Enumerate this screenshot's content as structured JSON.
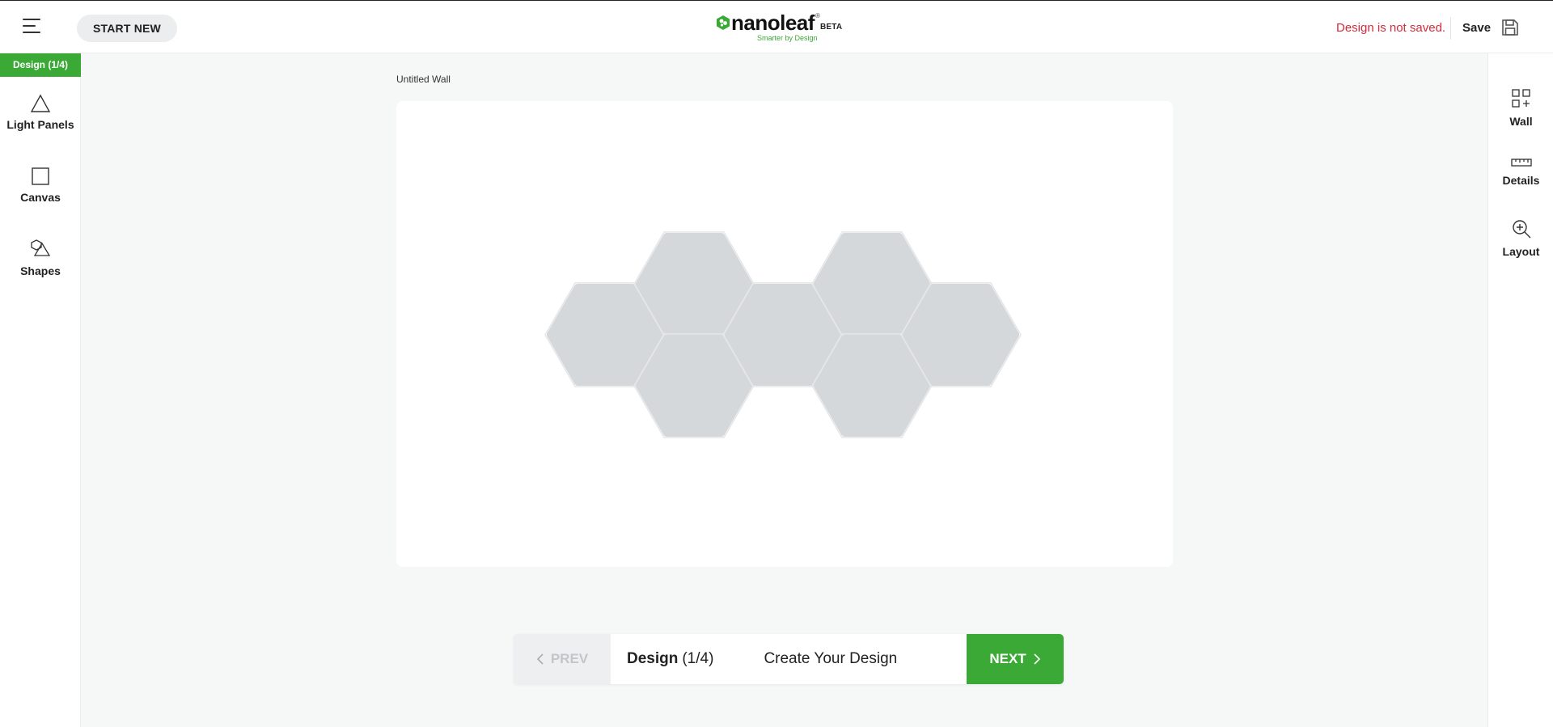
{
  "header": {
    "start_new_label": "START NEW",
    "logo": {
      "wordmark": "nanoleaf",
      "registered": "®",
      "beta": "BETA",
      "tagline": "Smarter by Design"
    },
    "status_text": "Design is not saved.",
    "save_label": "Save"
  },
  "left_toolbar": {
    "step_badge": "Design (1/4)",
    "tools": [
      {
        "label": "Light Panels",
        "icon": "triangle-icon"
      },
      {
        "label": "Canvas",
        "icon": "square-icon"
      },
      {
        "label": "Shapes",
        "icon": "shapes-icon"
      }
    ]
  },
  "right_toolbar": {
    "tools": [
      {
        "label": "Wall",
        "icon": "grid-add-icon"
      },
      {
        "label": "Details",
        "icon": "ruler-icon"
      },
      {
        "label": "Layout",
        "icon": "zoom-in-icon"
      }
    ]
  },
  "main": {
    "wall_title": "Untitled Wall",
    "hex_panel_count": 7
  },
  "step_bar": {
    "prev_label": "PREV",
    "step_name": "Design",
    "step_count": "(1/4)",
    "step_description": "Create Your Design",
    "next_label": "NEXT"
  },
  "colors": {
    "brand_green": "#3aa935",
    "warning_red": "#d62a3a",
    "panel_fill": "#d5d8db",
    "background": "#f6f7f7"
  }
}
